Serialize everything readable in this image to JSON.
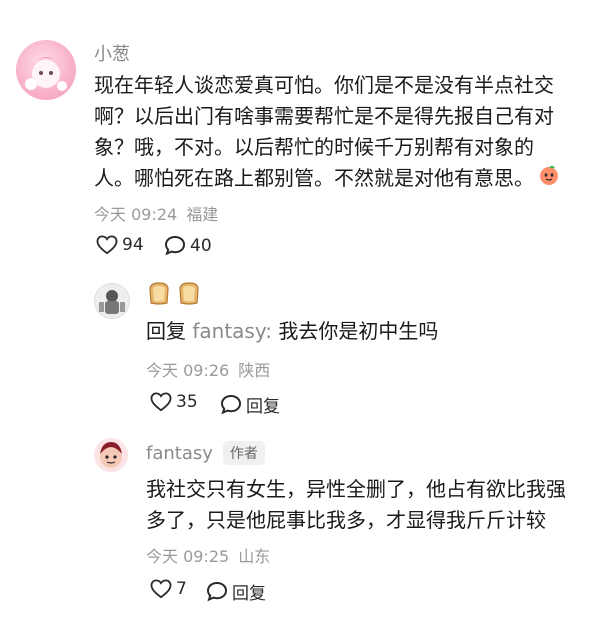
{
  "comment": {
    "username": "小葱",
    "text_lines": [
      "现在年轻人谈恋爱真可怕。你们是不是没有半点社交",
      "啊？以后出门有啥事需要帮忙是不是得先报自己有对",
      "象？哦，不对。以后帮忙的时候千万别帮有对象的",
      "人。哪怕死在路上都别管。不然就是对他有意思。"
    ],
    "emoji": "peach-emoji",
    "time": "今天 09:24",
    "location": "福建",
    "likes": "94",
    "replies": "40"
  },
  "reply1": {
    "emoji_text": "🍞🍞",
    "prefix": "回复",
    "target": "fantasy:",
    "text": "我去你是初中生吗",
    "time": "今天 09:26",
    "location": "陕西",
    "likes": "35",
    "reply_label": "回复"
  },
  "reply2": {
    "username": "fantasy",
    "badge": "作者",
    "text_lines": [
      "我社交只有女生，异性全删了，他占有欲比我强",
      "多了，只是他屁事比我多，才显得我斤斤计较"
    ],
    "time": "今天 09:25",
    "location": "山东",
    "likes": "7",
    "reply_label": "回复"
  },
  "colors": {
    "text": "#1a1a1a",
    "muted": "#9a9a9a",
    "badge_bg": "#f0f0f0"
  }
}
